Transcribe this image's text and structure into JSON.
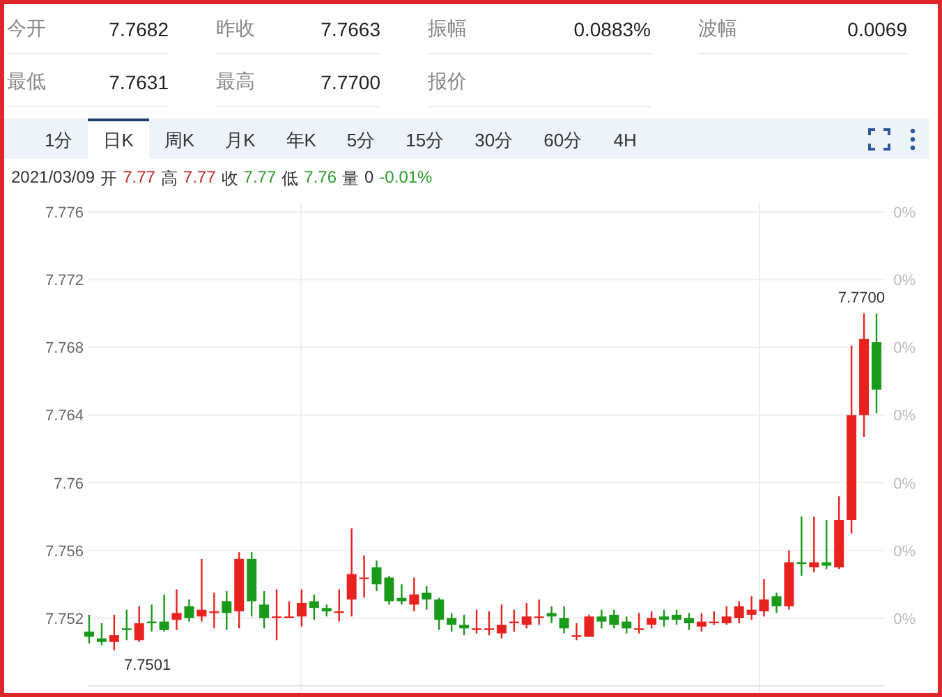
{
  "quote": [
    {
      "label": "今开",
      "value": "7.7682"
    },
    {
      "label": "昨收",
      "value": "7.7663"
    },
    {
      "label": "振幅",
      "value": "0.0883%"
    },
    {
      "label": "波幅",
      "value": "0.0069"
    },
    {
      "label": "最低",
      "value": "7.7631"
    },
    {
      "label": "最高",
      "value": "7.7700"
    },
    {
      "label": "报价"
    }
  ],
  "tabs": [
    {
      "label": "1分",
      "selected": false
    },
    {
      "label": "日K",
      "selected": true
    },
    {
      "label": "周K",
      "selected": false
    },
    {
      "label": "月K",
      "selected": false
    },
    {
      "label": "年K",
      "selected": false
    },
    {
      "label": "5分",
      "selected": false
    },
    {
      "label": "15分",
      "selected": false
    },
    {
      "label": "30分",
      "selected": false
    },
    {
      "label": "60分",
      "selected": false
    },
    {
      "label": "4H",
      "selected": false
    }
  ],
  "ohlc": {
    "date": "2021/03/09",
    "items": [
      {
        "label": "开",
        "value": "7.77",
        "color": "#c0282d"
      },
      {
        "label": "高",
        "value": "7.77",
        "color": "#c0282d"
      },
      {
        "label": "收",
        "value": "7.77",
        "color": "#2c9a2c"
      },
      {
        "label": "低",
        "value": "7.76",
        "color": "#2c9a2c"
      },
      {
        "label": "量",
        "value": "0",
        "color": "#333333"
      }
    ],
    "change": "-0.01%"
  },
  "chart": {
    "right_labels": [
      "0%",
      "0%",
      "0%",
      "0%",
      "0%",
      "0%",
      "0%"
    ],
    "min_label": "7.7501",
    "max_label": "7.7700",
    "chart_data": {
      "type": "candlestick",
      "grid": true,
      "ylim": [
        7.748,
        7.776
      ],
      "yticks": [
        7.776,
        7.772,
        7.768,
        7.764,
        {
          "value": 7.76,
          "label": "7.76"
        },
        7.756,
        7.752
      ],
      "ohlc": [
        [
          7.7512,
          7.7522,
          7.7505,
          7.7509
        ],
        [
          7.7508,
          7.7517,
          7.7504,
          7.7506
        ],
        [
          7.7506,
          7.7522,
          7.7501,
          7.751
        ],
        [
          7.7514,
          7.7525,
          7.7507,
          7.7513
        ],
        [
          7.7507,
          7.7527,
          7.7506,
          7.7517
        ],
        [
          7.7518,
          7.7528,
          7.7512,
          7.7517
        ],
        [
          7.7518,
          7.7534,
          7.7512,
          7.7513
        ],
        [
          7.7519,
          7.7537,
          7.7513,
          7.7523
        ],
        [
          7.7527,
          7.7531,
          7.7518,
          7.752
        ],
        [
          7.7521,
          7.7555,
          7.7518,
          7.7525
        ],
        [
          7.7524,
          7.7535,
          7.7514,
          7.7524
        ],
        [
          7.753,
          7.7536,
          7.7513,
          7.7523
        ],
        [
          7.7524,
          7.7559,
          7.7514,
          7.7555
        ],
        [
          7.7555,
          7.7559,
          7.7521,
          7.753
        ],
        [
          7.7528,
          7.7536,
          7.7514,
          7.752
        ],
        [
          7.7521,
          7.7537,
          7.7507,
          7.7521
        ],
        [
          7.7521,
          7.753,
          7.752,
          7.7521
        ],
        [
          7.7521,
          7.7537,
          7.7515,
          7.7529
        ],
        [
          7.753,
          7.7534,
          7.7519,
          7.7526
        ],
        [
          7.7526,
          7.7528,
          7.7521,
          7.7524
        ],
        [
          7.7524,
          7.7537,
          7.7518,
          7.7524
        ],
        [
          7.7531,
          7.7573,
          7.7521,
          7.7546
        ],
        [
          7.7544,
          7.7557,
          7.7532,
          7.7544
        ],
        [
          7.755,
          7.7554,
          7.7536,
          7.754
        ],
        [
          7.7544,
          7.7545,
          7.7528,
          7.753
        ],
        [
          7.7532,
          7.754,
          7.7528,
          7.753
        ],
        [
          7.7528,
          7.7544,
          7.7524,
          7.7534
        ],
        [
          7.7535,
          7.7539,
          7.7525,
          7.7531
        ],
        [
          7.7531,
          7.7532,
          7.7513,
          7.7519
        ],
        [
          7.752,
          7.7523,
          7.7512,
          7.7516
        ],
        [
          7.7516,
          7.7522,
          7.751,
          7.7514
        ],
        [
          7.7513,
          7.7525,
          7.7511,
          7.7514
        ],
        [
          7.7514,
          7.7524,
          7.751,
          7.7514
        ],
        [
          7.7511,
          7.7528,
          7.7508,
          7.7516
        ],
        [
          7.7517,
          7.7525,
          7.7512,
          7.7518
        ],
        [
          7.7516,
          7.7529,
          7.7514,
          7.7521
        ],
        [
          7.7521,
          7.7531,
          7.7516,
          7.7521
        ],
        [
          7.7523,
          7.7527,
          7.7517,
          7.7521
        ],
        [
          7.752,
          7.7527,
          7.7511,
          7.7514
        ],
        [
          7.7509,
          7.7517,
          7.7507,
          7.751
        ],
        [
          7.7509,
          7.7522,
          7.7509,
          7.7521
        ],
        [
          7.7521,
          7.7525,
          7.7514,
          7.7518
        ],
        [
          7.7522,
          7.7525,
          7.7514,
          7.7516
        ],
        [
          7.7518,
          7.7521,
          7.7511,
          7.7514
        ],
        [
          7.7514,
          7.7523,
          7.7511,
          7.7514
        ],
        [
          7.7516,
          7.7524,
          7.7514,
          7.752
        ],
        [
          7.7521,
          7.7525,
          7.7515,
          7.7519
        ],
        [
          7.7522,
          7.7525,
          7.7516,
          7.7519
        ],
        [
          7.752,
          7.7523,
          7.7513,
          7.7517
        ],
        [
          7.7515,
          7.7523,
          7.7512,
          7.7518
        ],
        [
          7.7518,
          7.7524,
          7.7516,
          7.7518
        ],
        [
          7.7517,
          7.7527,
          7.7516,
          7.7521
        ],
        [
          7.752,
          7.753,
          7.7517,
          7.7527
        ],
        [
          7.7522,
          7.7533,
          7.7519,
          7.7525
        ],
        [
          7.7524,
          7.7543,
          7.7521,
          7.7531
        ],
        [
          7.7533,
          7.7535,
          7.7523,
          7.7527
        ],
        [
          7.7527,
          7.756,
          7.7525,
          7.7553
        ],
        [
          7.7553,
          7.758,
          7.7545,
          7.7552
        ],
        [
          7.755,
          7.758,
          7.7547,
          7.7553
        ],
        [
          7.7553,
          7.7578,
          7.7549,
          7.7551
        ],
        [
          7.755,
          7.7592,
          7.7549,
          7.7578
        ],
        [
          7.7578,
          7.7681,
          7.757,
          7.764
        ],
        [
          7.764,
          7.77,
          7.7627,
          7.7685
        ],
        [
          7.7683,
          7.77,
          7.7641,
          7.7655
        ]
      ]
    }
  }
}
